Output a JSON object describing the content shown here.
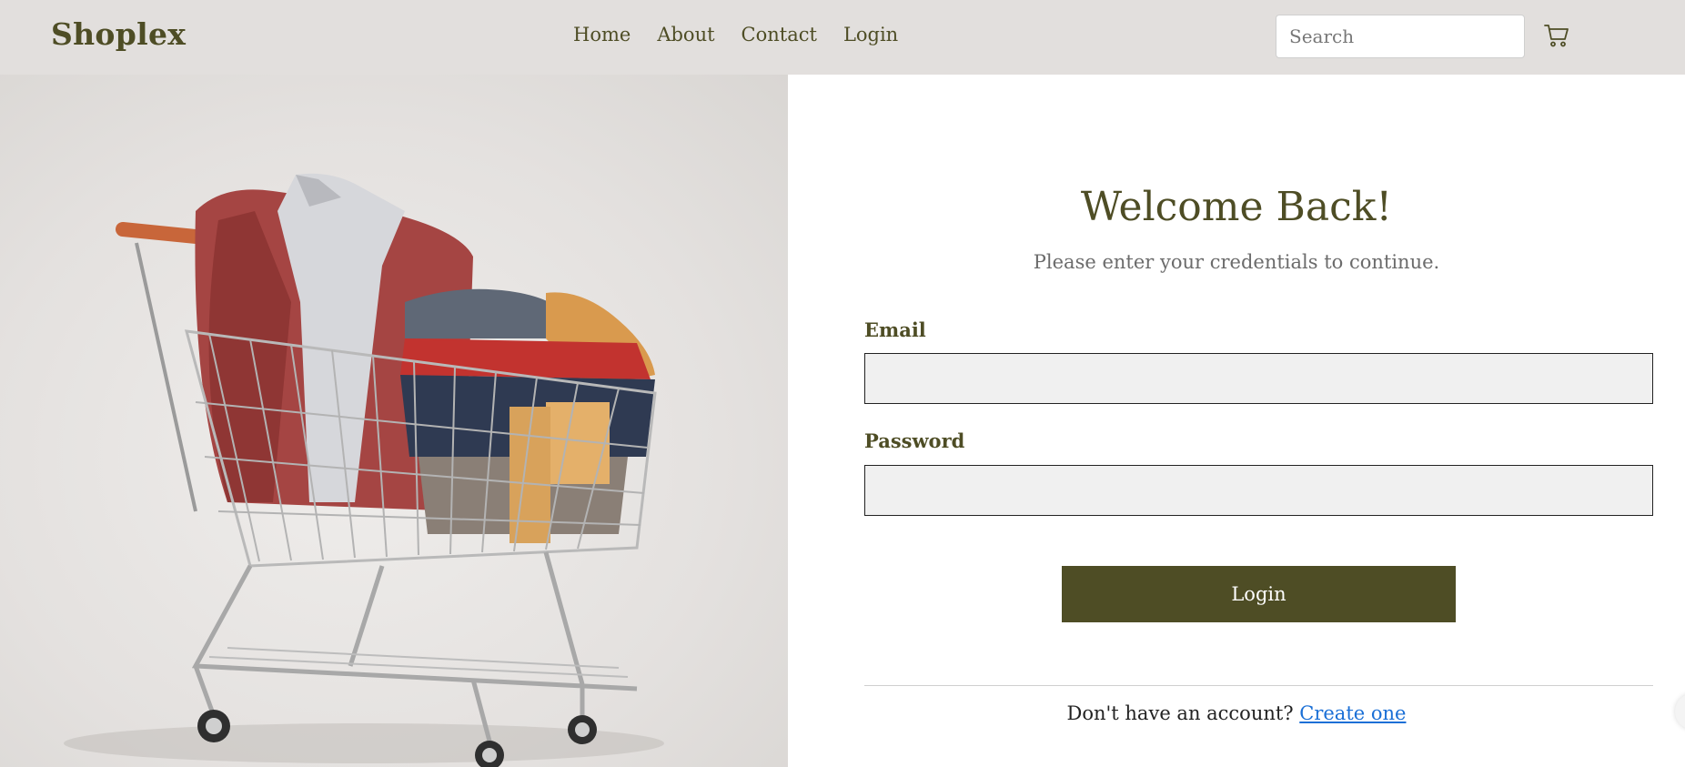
{
  "header": {
    "brand": "Shoplex",
    "nav": [
      "Home",
      "About",
      "Contact",
      "Login"
    ],
    "search_placeholder": "Search",
    "cart_icon": "cart-icon"
  },
  "hero": {
    "image": "shopping-cart-with-clothes"
  },
  "login": {
    "title": "Welcome Back!",
    "subtitle": "Please enter your credentials to continue.",
    "email_label": "Email",
    "email_value": "",
    "password_label": "Password",
    "password_value": "",
    "button_label": "Login",
    "signup_text": "Don't have an account?",
    "signup_link": "Create one"
  },
  "colors": {
    "brand": "#4e4d25",
    "header_bg": "#e2dfdd",
    "link": "#1a6fd6"
  }
}
